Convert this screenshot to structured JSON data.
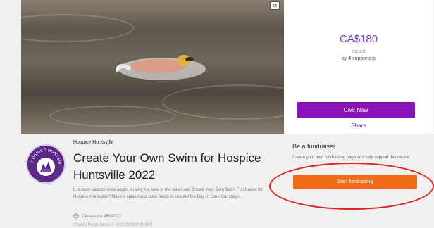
{
  "campaign": {
    "amount": "CA$180",
    "raised_label": "raised",
    "supporters_prefix": "by",
    "supporters_count": "4",
    "supporters_suffix": "supporters",
    "give_label": "Give Now",
    "share_label": "Share"
  },
  "org": {
    "name": "Hospice Huntsville",
    "logo_text": "HOSPICE HUNTSVILLE"
  },
  "page": {
    "title": "Create Your Own Swim for Hospice Huntsville 2022",
    "description": "It is swim season once again, so why not take to the water and Create Your Own Swim Fundraiser for Hospice Huntsville? Make a splash and raise funds to support the Day of Care Campaign.",
    "closes": "Closes on 9/5/2022",
    "charity_number": "Charity Registration #: 890350063RR0001"
  },
  "fundraiser": {
    "heading": "Be a fundraiser",
    "description": "Create your own fundraising page and help support this cause.",
    "button_label": "Start fundraising"
  },
  "colors": {
    "accent": "#8b12b7",
    "orange": "#f26a16",
    "annotation": "#e32020"
  }
}
